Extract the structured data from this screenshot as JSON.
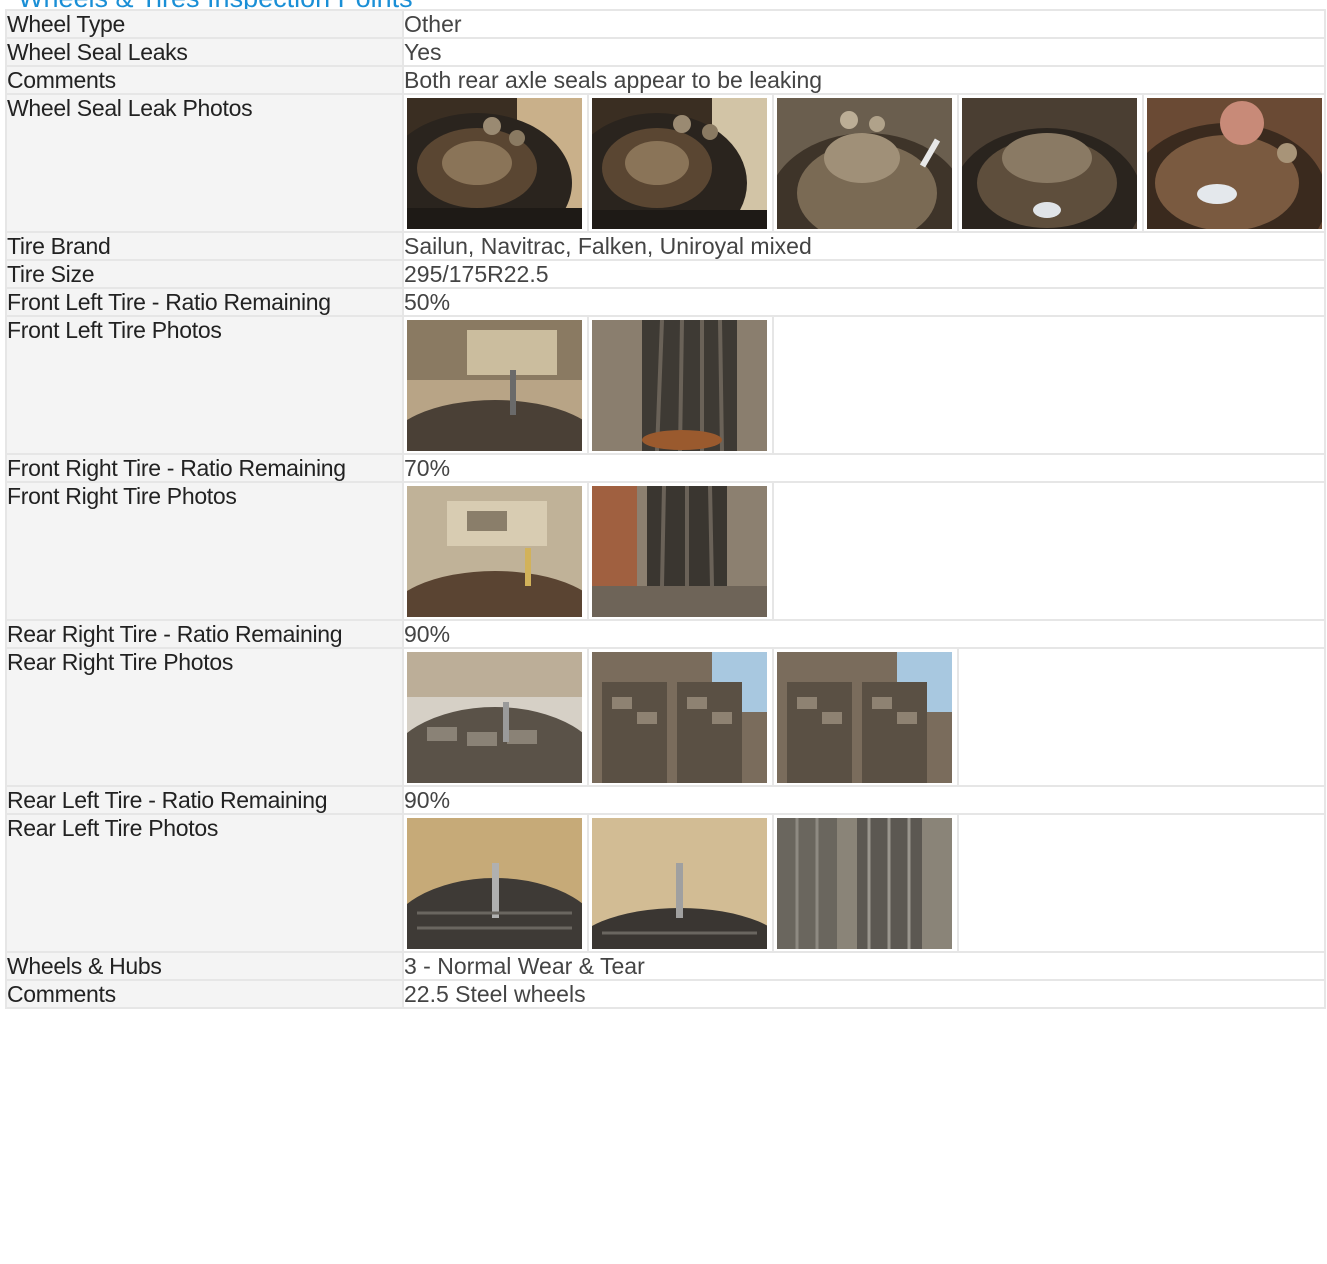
{
  "section": {
    "title": "Wheels & Tires Inspection Points"
  },
  "rows": [
    {
      "label": "Wheel Type",
      "value": "Other"
    },
    {
      "label": "Wheel Seal Leaks",
      "value": "Yes"
    },
    {
      "label": "Comments",
      "value": "Both rear axle seals appear to be leaking"
    },
    {
      "label": "Wheel Seal Leak Photos",
      "photo_count": 5
    },
    {
      "label": "Tire Brand",
      "value": "Sailun, Navitrac, Falken, Uniroyal mixed"
    },
    {
      "label": "Tire Size",
      "value": "295/175R22.5"
    },
    {
      "label": "Front Left Tire - Ratio Remaining",
      "value": "50%"
    },
    {
      "label": "Front Left Tire Photos",
      "photo_count": 2
    },
    {
      "label": "Front Right Tire - Ratio Remaining",
      "value": "70%"
    },
    {
      "label": "Front Right Tire Photos",
      "photo_count": 2
    },
    {
      "label": "Rear Right Tire - Ratio Remaining",
      "value": "90%"
    },
    {
      "label": "Rear Right Tire Photos",
      "photo_count": 3
    },
    {
      "label": "Rear Left Tire - Ratio Remaining",
      "value": "90%"
    },
    {
      "label": "Rear Left Tire Photos",
      "photo_count": 3
    },
    {
      "label": "Wheels & Hubs",
      "value": "3 - Normal Wear & Tear"
    },
    {
      "label": "Comments",
      "value": "22.5 Steel wheels"
    }
  ],
  "colors": {
    "title": "#1a8fd6",
    "label_bg": "#f4f4f4",
    "border": "#e6e6e6"
  }
}
